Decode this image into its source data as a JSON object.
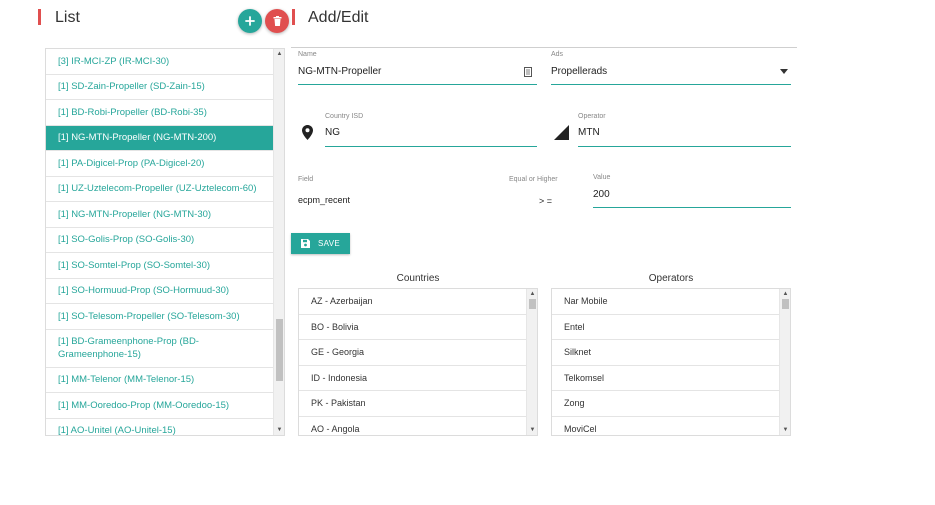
{
  "list_section": {
    "title": "List"
  },
  "edit_section": {
    "title": "Add/Edit"
  },
  "colors": {
    "accent": "#26a69a",
    "danger": "#e04f4f"
  },
  "list": {
    "items": [
      {
        "label": "[3] IR-MCI-ZP (IR-MCI-30)",
        "active": false
      },
      {
        "label": "[1] SD-Zain-Propeller (SD-Zain-15)",
        "active": false
      },
      {
        "label": "[1] BD-Robi-Propeller (BD-Robi-35)",
        "active": false
      },
      {
        "label": "[1] NG-MTN-Propeller (NG-MTN-200)",
        "active": true
      },
      {
        "label": "[1] PA-Digicel-Prop (PA-Digicel-20)",
        "active": false
      },
      {
        "label": "[1] UZ-Uztelecom-Propeller (UZ-Uztelecom-60)",
        "active": false
      },
      {
        "label": "[1] NG-MTN-Propeller (NG-MTN-30)",
        "active": false
      },
      {
        "label": "[1] SO-Golis-Prop (SO-Golis-30)",
        "active": false
      },
      {
        "label": "[1] SO-Somtel-Prop (SO-Somtel-30)",
        "active": false
      },
      {
        "label": "[1] SO-Hormuud-Prop (SO-Hormuud-30)",
        "active": false
      },
      {
        "label": "[1] SO-Telesom-Propeller (SO-Telesom-30)",
        "active": false
      },
      {
        "label": "[1] BD-Grameenphone-Prop (BD-Grameenphone-15)",
        "active": false
      },
      {
        "label": "[1] MM-Telenor (MM-Telenor-15)",
        "active": false
      },
      {
        "label": "[1] MM-Ooredoo-Prop (MM-Ooredoo-15)",
        "active": false
      },
      {
        "label": "[1] AO-Unitel (AO-Unitel-15)",
        "active": false
      }
    ]
  },
  "form": {
    "name": {
      "label": "Name",
      "value": "NG-MTN-Propeller"
    },
    "ads": {
      "label": "Ads",
      "value": "Propellerads"
    },
    "country_isd": {
      "label": "Country ISD",
      "value": "NG"
    },
    "operator": {
      "label": "Operator",
      "value": "MTN"
    },
    "field": {
      "label": "Field",
      "value": "ecpm_recent"
    },
    "equal": {
      "label": "Equal or Higher",
      "value": "> ="
    },
    "value": {
      "label": "Value",
      "value": "200"
    },
    "save_label": "SAVE"
  },
  "countries": {
    "title": "Countries",
    "rows": [
      "AZ - Azerbaijan",
      "BO - Bolivia",
      "GE - Georgia",
      "ID - Indonesia",
      "PK - Pakistan",
      "AO - Angola"
    ]
  },
  "operators": {
    "title": "Operators",
    "rows": [
      "Nar Mobile",
      "Entel",
      "Silknet",
      "Telkomsel",
      "Zong",
      "MoviCel"
    ]
  }
}
